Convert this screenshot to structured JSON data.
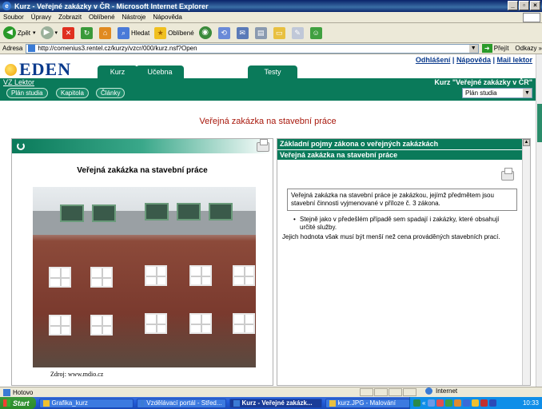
{
  "window": {
    "title": "Kurz - Veřejné zakázky v ČR - Microsoft Internet Explorer",
    "buttons": [
      "_",
      "▫",
      "×"
    ]
  },
  "menu": [
    "Soubor",
    "Úpravy",
    "Zobrazit",
    "Oblíbené",
    "Nástroje",
    "Nápověda"
  ],
  "toolbar": {
    "back": "Zpět",
    "search": "Hledat",
    "favorites": "Oblíbené"
  },
  "address": {
    "label": "Adresa",
    "url": "http://comenius3.rentel.cz/kurzy/vzcr/000/kurz.nsf?Open",
    "go": "Přejít",
    "links": "Odkazy"
  },
  "site": {
    "logo": "EDEN",
    "tabs": [
      "Kurz",
      "Učebna",
      "Testy"
    ],
    "top_links": [
      "Odhlášení",
      "Nápověda",
      "Mail lektor"
    ],
    "vz_lektor": "VZ Lektor",
    "course_title": "Kurz \"Veřejné zakázky v ČR\"",
    "nav_buttons": [
      "Plán studia",
      "Kapitola",
      "Články"
    ],
    "study_select": "Plán studia"
  },
  "main": {
    "title": "Veřejná zakázka na stavební práce"
  },
  "left_panel": {
    "title": "Veřejná zakázka na stavební práce",
    "source": "Zdroj: www.mdio.cz"
  },
  "right_panel": {
    "header": "Základní pojmy zákona o veřejných zakázkách",
    "subheader": "Veřejná zakázka na stavební práce",
    "definition": "Veřejná zakázka na stavební práce je zakázkou, jejímž předmětem jsou stavební činnosti vyjmenované v příloze č. 3 zákona.",
    "bullet": "Stejně jako v předešlém případě sem spadají i zakázky, které obsahují určité služby.",
    "limit": "Jejich hodnota však musí být menší než cena prováděných stavebních prací."
  },
  "status": {
    "text": "Hotovo",
    "zone": "Internet"
  },
  "taskbar": {
    "start": "Start",
    "tasks": [
      "Grafika_kurz",
      "Vzdělávací portál - Střed...",
      "Kurz - Veřejné zakázk...",
      "kurz.JPG - Malování"
    ],
    "clock": "10:33"
  },
  "colors": {
    "eden_green": "#0a7a5a",
    "title_red": "#a8180c",
    "xp_blue": "#245edb"
  }
}
